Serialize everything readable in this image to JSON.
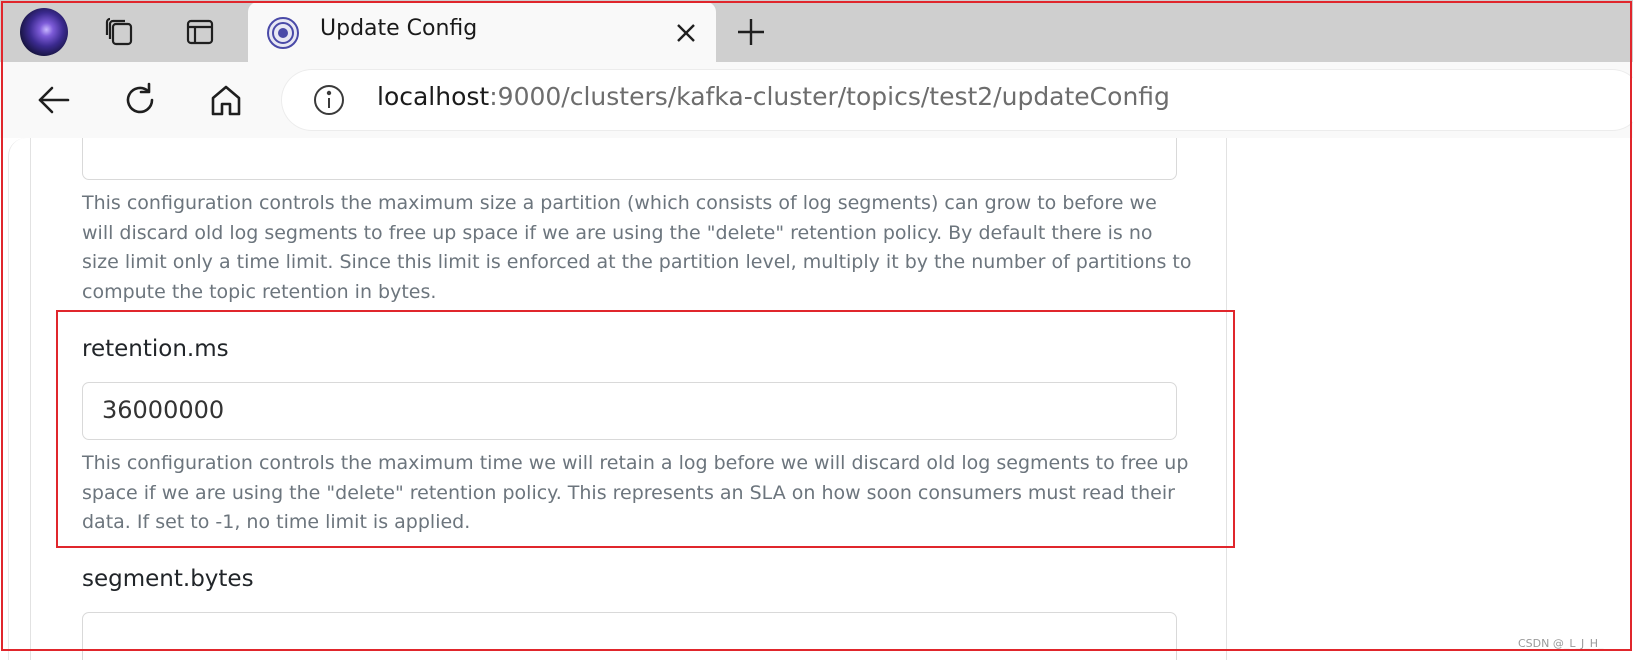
{
  "browser": {
    "tab": {
      "title": "Update Config"
    },
    "address": {
      "host": "localhost",
      "path": ":9000/clusters/kafka-cluster/topics/test2/updateConfig"
    },
    "icons": {
      "profile": "profile-avatar-icon",
      "collections": "collections-icon",
      "tab_actions": "tab-actions-icon",
      "favicon": "site-favicon-icon",
      "close": "close-icon",
      "new_tab": "plus-icon",
      "back": "back-arrow-icon",
      "refresh": "refresh-icon",
      "home": "home-icon",
      "info": "info-icon"
    }
  },
  "form": {
    "previous_field": {
      "value": "",
      "help": "This configuration controls the maximum size a partition (which consists of log segments) can grow to before we will discard old log segments to free up space if we are using the \"delete\" retention policy. By default there is no size limit only a time limit. Since this limit is enforced at the partition level, multiply it by the number of partitions to compute the topic retention in bytes."
    },
    "retention_ms": {
      "label": "retention.ms",
      "value": "36000000",
      "help": "This configuration controls the maximum time we will retain a log before we will discard old log segments to free up space if we are using the \"delete\" retention policy. This represents an SLA on how soon consumers must read their data. If set to -1, no time limit is applied."
    },
    "segment_bytes": {
      "label": "segment.bytes",
      "value": ""
    }
  },
  "watermark": "CSDN @_L_J_H_",
  "colors": {
    "annotation": "#e0262c",
    "tabstrip": "#cfcfcf",
    "help_text": "#6c757d"
  }
}
